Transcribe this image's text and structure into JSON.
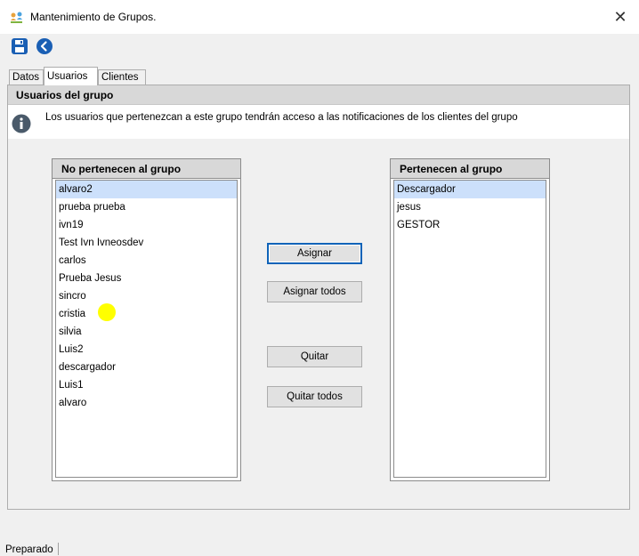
{
  "window": {
    "title": "Mantenimiento de Grupos.",
    "close_glyph": "✕"
  },
  "toolbar": {
    "save_icon": "save-icon",
    "back_icon": "back-arrow-icon"
  },
  "tabs": [
    {
      "label": "Datos",
      "active": false
    },
    {
      "label": "Usuarios",
      "active": true
    },
    {
      "label": "Clientes",
      "active": false
    }
  ],
  "group": {
    "title": "Usuarios del grupo",
    "info": "Los usuarios que pertenezcan a este grupo tendrán acceso a las notificaciones de los clientes del grupo"
  },
  "left_list": {
    "header": "No pertenecen al grupo",
    "items": [
      "alvaro2",
      "prueba prueba",
      "ivn19",
      "Test Ivn Ivneosdev",
      "carlos",
      "Prueba Jesus",
      "sincro",
      "cristia",
      "silvia",
      "Luis2",
      "descargador",
      "Luis1",
      "alvaro"
    ],
    "selected_index": 0
  },
  "right_list": {
    "header": "Pertenecen al grupo",
    "items": [
      "Descargador",
      "jesus",
      "GESTOR"
    ],
    "selected_index": 0
  },
  "buttons": {
    "assign": "Asignar",
    "assign_all": "Asignar todos",
    "remove": "Quitar",
    "remove_all": "Quitar todos"
  },
  "status": {
    "text": "Preparado"
  },
  "colors": {
    "accent": "#0f63b8",
    "selection": "#cce0fb",
    "header_bg": "#d8d8d8",
    "info_icon": "#4a5a6a"
  }
}
